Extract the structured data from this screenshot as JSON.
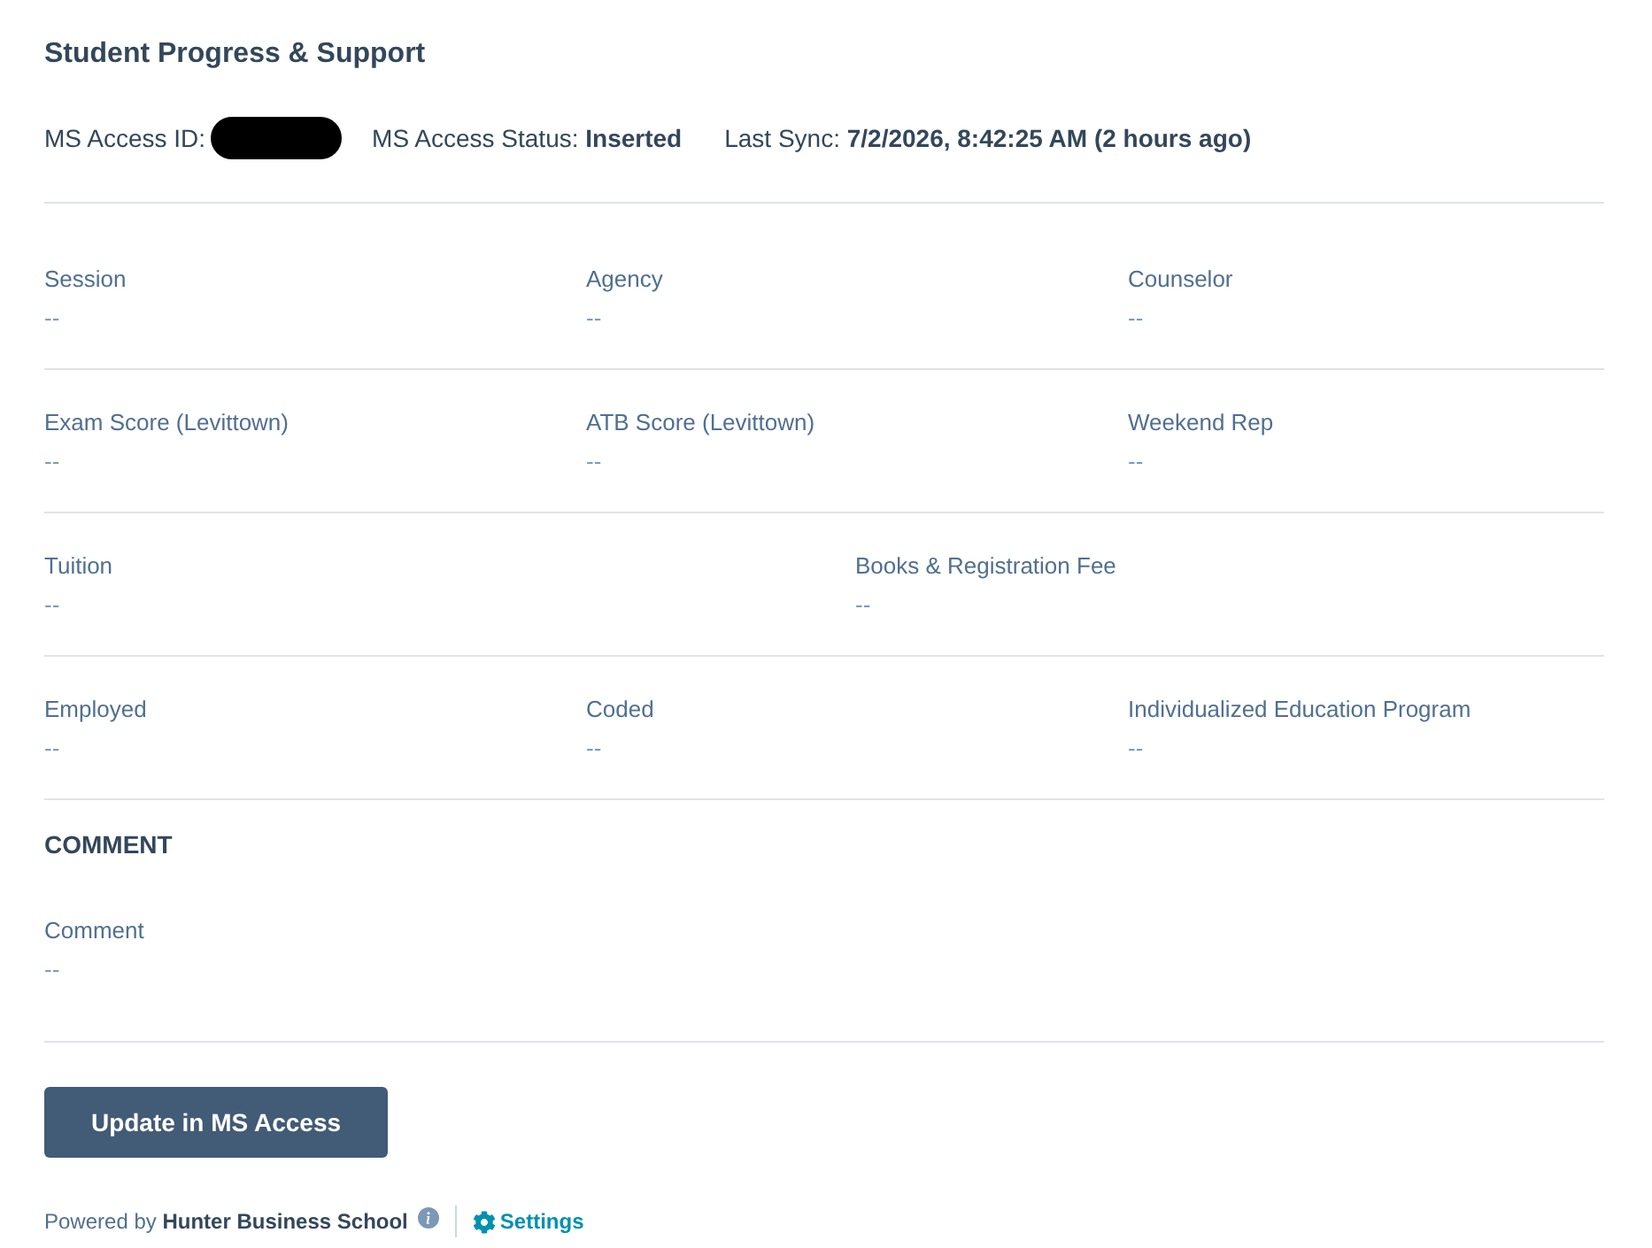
{
  "card": {
    "title": "Student Progress & Support"
  },
  "status_line": {
    "id_label": "MS Access ID:",
    "id_redacted": true,
    "status": "MS Access Status: **Inserted**",
    "sync": "Last Sync: **7/2/2026, 8:42:25 AM (2 hours ago)**"
  },
  "field_rows": [
    {
      "fields": [
        {
          "label": "Session",
          "value": "--"
        },
        {
          "label": "Agency",
          "value": "--"
        },
        {
          "label": "Counselor",
          "value": "--"
        }
      ]
    },
    {
      "fields": [
        {
          "label": "Exam Score (Levittown)",
          "value": "--"
        },
        {
          "label": "ATB Score (Levittown)",
          "value": "--"
        },
        {
          "label": "Weekend Rep",
          "value": "--"
        }
      ]
    },
    {
      "fields": [
        {
          "label": "Tuition",
          "value": "--"
        },
        {
          "label": "Books & Registration Fee",
          "value": "--"
        }
      ]
    },
    {
      "fields": [
        {
          "label": "Employed",
          "value": "--"
        },
        {
          "label": "Coded",
          "value": "--"
        },
        {
          "label": "Individualized Education Program",
          "value": "--"
        }
      ]
    }
  ],
  "comment_section": {
    "heading": "COMMENT",
    "fields": [
      {
        "label": "Comment",
        "value": "--"
      }
    ]
  },
  "update_button": {
    "label": "Update in MS Access"
  },
  "footer": {
    "powered_by": "Powered by **Hunter Business School**",
    "settings_link": "Settings"
  }
}
